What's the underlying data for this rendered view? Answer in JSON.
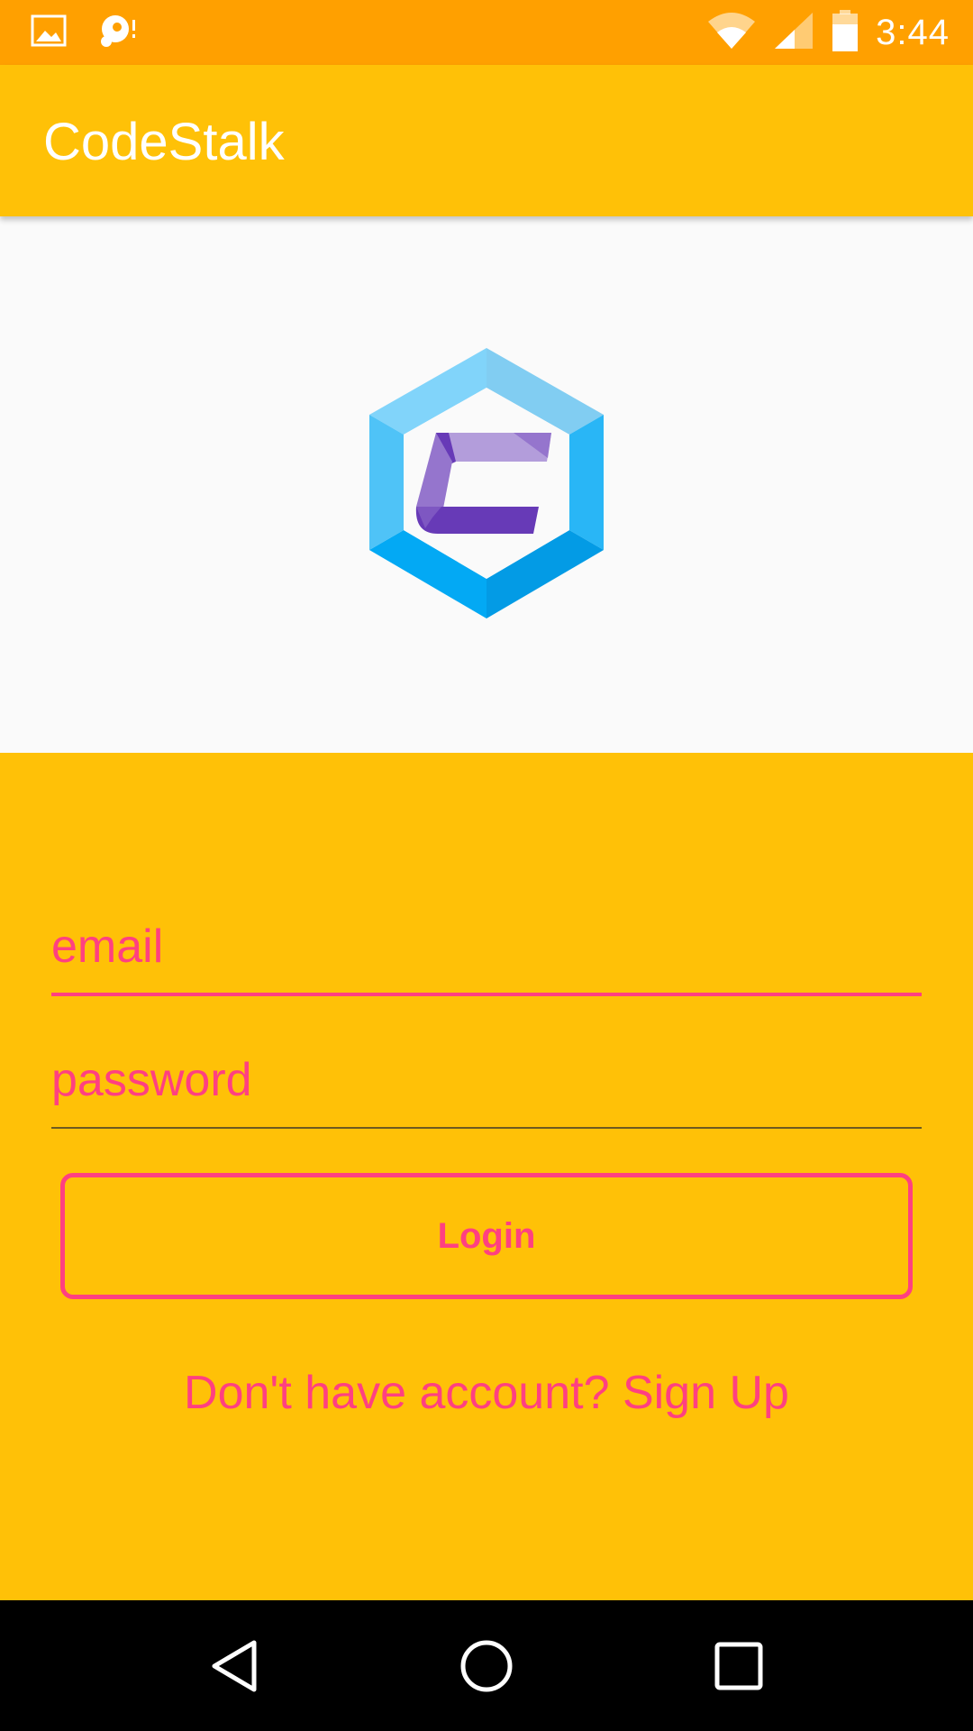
{
  "status_bar": {
    "time": "3:44",
    "icons": [
      "image-icon",
      "sync-icon",
      "wifi-icon",
      "cell-signal-icon",
      "battery-icon"
    ]
  },
  "app_bar": {
    "title": "CodeStalk"
  },
  "logo": {
    "name": "codestalk-logo",
    "colors": {
      "hex_light": "#81d4fa",
      "hex_mid": "#4fc3f7",
      "hex_dark": "#03a9f4",
      "c_dark": "#673ab7",
      "c_light": "#b39ddb"
    }
  },
  "form": {
    "email_placeholder": "email",
    "password_placeholder": "password",
    "login_label": "Login",
    "signup_text": "Don't have account? Sign Up"
  },
  "nav_bar": {
    "icons": [
      "back-icon",
      "home-icon",
      "recents-icon"
    ]
  },
  "colors": {
    "status_bar": "#ffa000",
    "primary": "#ffc107",
    "accent": "#ff4081"
  }
}
